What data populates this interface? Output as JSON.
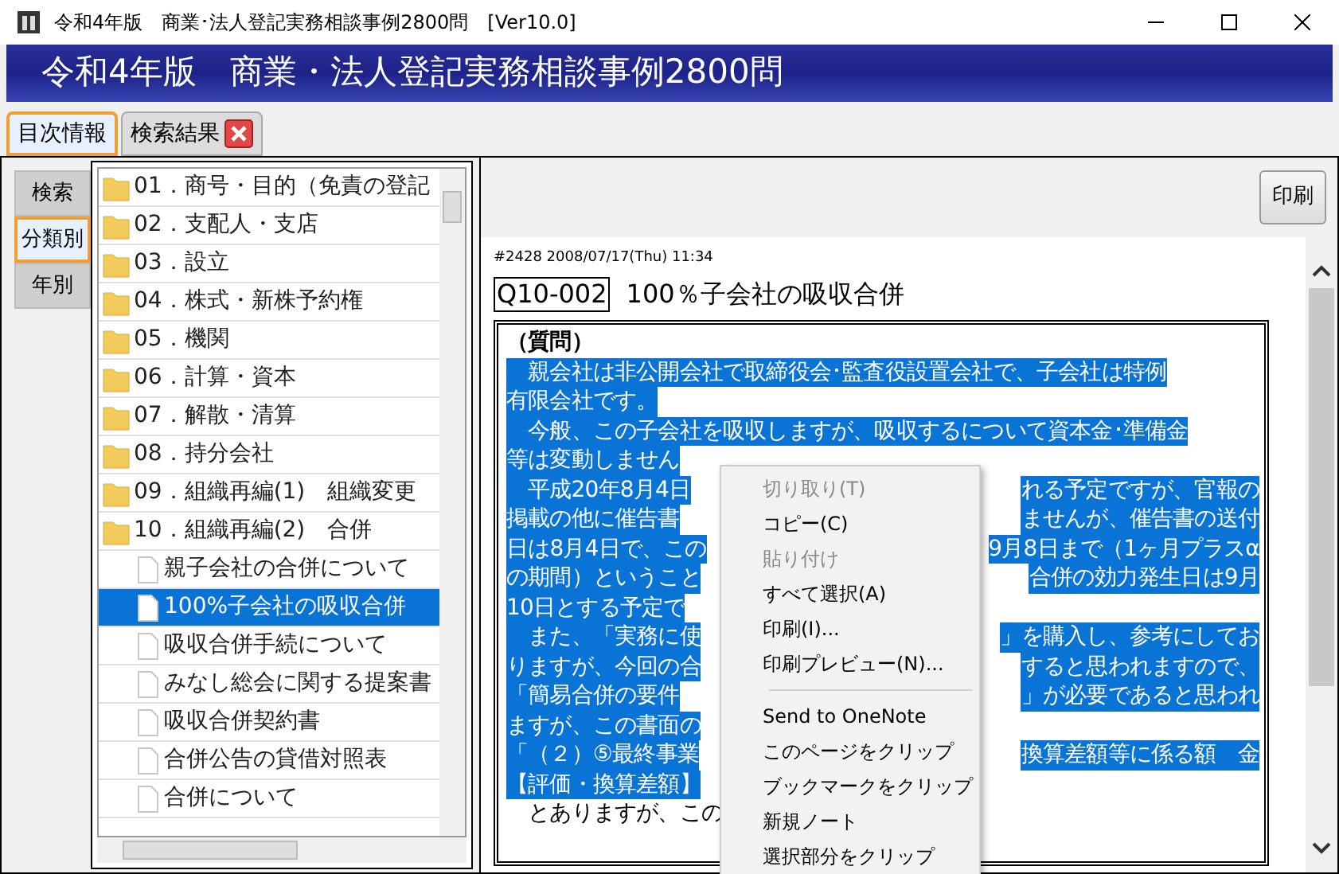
{
  "window": {
    "title": "令和4年版　商業･法人登記実務相談事例2800問　[Ver10.0]"
  },
  "header": {
    "title": "令和4年版　商業・法人登記実務相談事例2800問"
  },
  "tabs": [
    {
      "label": "目次情報",
      "selected": true,
      "closable": false
    },
    {
      "label": "検索結果",
      "selected": false,
      "closable": true
    }
  ],
  "side_tabs": [
    {
      "label": "検索",
      "selected": false
    },
    {
      "label": "分類別",
      "selected": true
    },
    {
      "label": "年別",
      "selected": false
    }
  ],
  "tree": [
    {
      "kind": "folder",
      "label": "01．商号・目的（免責の登記",
      "selected": false
    },
    {
      "kind": "folder",
      "label": "02．支配人・支店",
      "selected": false
    },
    {
      "kind": "folder",
      "label": "03．設立",
      "selected": false
    },
    {
      "kind": "folder",
      "label": "04．株式・新株予約権",
      "selected": false
    },
    {
      "kind": "folder",
      "label": "05．機関",
      "selected": false
    },
    {
      "kind": "folder",
      "label": "06．計算・資本",
      "selected": false
    },
    {
      "kind": "folder",
      "label": "07．解散・清算",
      "selected": false
    },
    {
      "kind": "folder",
      "label": "08．持分会社",
      "selected": false
    },
    {
      "kind": "folder",
      "label": "09．組織再編(1)　組織変更",
      "selected": false
    },
    {
      "kind": "folder",
      "label": "10．組織再編(2)　合併",
      "selected": false,
      "children": [
        {
          "kind": "doc",
          "label": "親子会社の合併について",
          "selected": false
        },
        {
          "kind": "doc",
          "label": "100%子会社の吸収合併",
          "selected": true
        },
        {
          "kind": "doc",
          "label": "吸収合併手続について",
          "selected": false
        },
        {
          "kind": "doc",
          "label": "みなし総会に関する提案書",
          "selected": false
        },
        {
          "kind": "doc",
          "label": "吸収合併契約書",
          "selected": false
        },
        {
          "kind": "doc",
          "label": "合併公告の貸借対照表",
          "selected": false
        },
        {
          "kind": "doc",
          "label": "合併について",
          "selected": false
        }
      ]
    }
  ],
  "print_button": "印刷",
  "document": {
    "meta": "#2428 2008/07/17(Thu) 11:34",
    "code": "Q10-002",
    "title": "100％子会社の吸収合併",
    "lines": [
      {
        "left": "（質問）",
        "highlighted": false,
        "bold": true
      },
      {
        "left": "　親会社は非公開会社で取締役会･監査役設置会社で、子会社は特例",
        "highlighted": true,
        "bold": false
      },
      {
        "left": "有限会社です。",
        "highlighted": true,
        "bold": false
      },
      {
        "left": "　今般、この子会社を吸収しますが、吸収するについて資本金･準備金",
        "highlighted": true,
        "bold": false
      },
      {
        "left": "等は変動しません",
        "highlighted": true,
        "bold": false
      },
      {
        "left": "　平成20年8月4日",
        "right": "れる予定ですが、官報の",
        "highlighted": true,
        "bold": false
      },
      {
        "left": "掲載の他に催告書",
        "right": "ませんが、催告書の送付",
        "highlighted": true,
        "bold": false
      },
      {
        "left": "日は8月4日で、この",
        "right": "9月8日まで（1ヶ月プラスα",
        "highlighted": true,
        "bold": false
      },
      {
        "left": "の期間）ということ",
        "right": "合併の効力発生日は9月",
        "highlighted": true,
        "bold": false
      },
      {
        "left": "10日とする予定で",
        "highlighted": true,
        "bold": false
      },
      {
        "left": "　また、「実務に使",
        "right": "」を購入し、参考にしてお",
        "highlighted": true,
        "bold": false
      },
      {
        "left": "りますが、今回の合",
        "right": "すると思われますので、",
        "highlighted": true,
        "bold": false
      },
      {
        "left": "「簡易合併の要件",
        "right": "」が必要であると思われ",
        "highlighted": true,
        "bold": false
      },
      {
        "left": "ますが、この書面の",
        "highlighted": true,
        "bold": false
      },
      {
        "left": "「（２）⑤最終事業",
        "right": "換算差額等に係る額　金",
        "highlighted": true,
        "bold": false
      },
      {
        "left": "【評価・換算差額】",
        "highlighted": true,
        "bold": false
      },
      {
        "left": "　とありますが、この",
        "highlighted": false,
        "bold": false
      }
    ]
  },
  "context_menu": [
    {
      "kind": "item",
      "label": "切り取り(T)",
      "disabled": true
    },
    {
      "kind": "item",
      "label": "コピー(C)",
      "disabled": false
    },
    {
      "kind": "item",
      "label": "貼り付け",
      "disabled": true
    },
    {
      "kind": "item",
      "label": "すべて選択(A)",
      "disabled": false
    },
    {
      "kind": "item",
      "label": "印刷(I)...",
      "disabled": false
    },
    {
      "kind": "item",
      "label": "印刷プレビュー(N)...",
      "disabled": false
    },
    {
      "kind": "separator"
    },
    {
      "kind": "item",
      "label": "Send to OneNote",
      "disabled": false
    },
    {
      "kind": "item",
      "label": "このページをクリップ",
      "disabled": false
    },
    {
      "kind": "item",
      "label": "ブックマークをクリップ",
      "disabled": false
    },
    {
      "kind": "item",
      "label": "新規ノート",
      "disabled": false
    },
    {
      "kind": "item",
      "label": "選択部分をクリップ",
      "disabled": false
    }
  ]
}
